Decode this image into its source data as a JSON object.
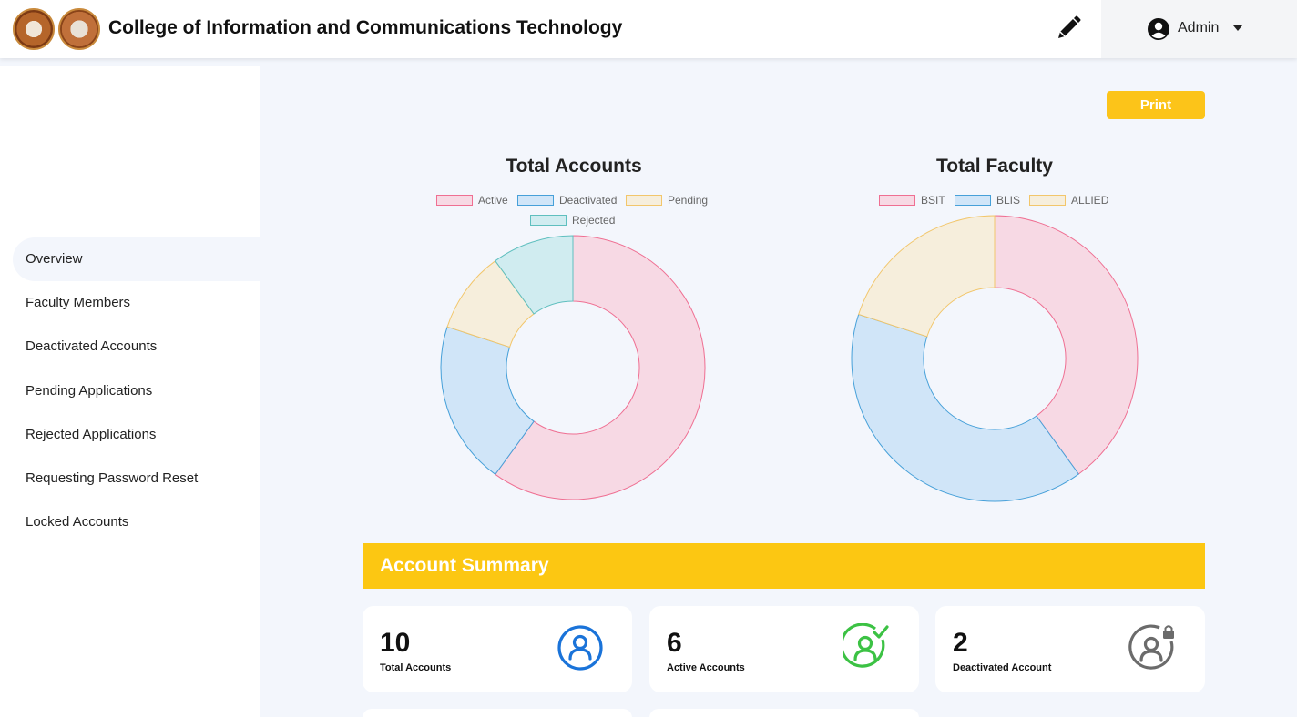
{
  "header": {
    "title": "College of Information and Communications Technology",
    "admin_label": "Admin",
    "edit_icon": "pencil-icon",
    "user_icon": "user-circle-icon"
  },
  "sidebar": {
    "items": [
      {
        "label": "Overview",
        "active": true
      },
      {
        "label": "Faculty Members"
      },
      {
        "label": "Deactivated Accounts"
      },
      {
        "label": "Pending Applications"
      },
      {
        "label": "Rejected Applications"
      },
      {
        "label": "Requesting Password Reset"
      },
      {
        "label": "Locked Accounts"
      }
    ]
  },
  "main": {
    "print_label": "Print",
    "summary_title": "Account Summary",
    "cards": [
      {
        "value": "10",
        "label": "Total Accounts",
        "icon": "user-circle-icon",
        "color": "#1a73d9"
      },
      {
        "value": "6",
        "label": "Active Accounts",
        "icon": "user-check-icon",
        "color": "#3cc244"
      },
      {
        "value": "2",
        "label": "Deactivated Account",
        "icon": "user-lock-icon",
        "color": "#6b6b6b"
      }
    ]
  },
  "chart_data": [
    {
      "type": "pie",
      "title": "Total Accounts",
      "categories": [
        "Active",
        "Deactivated",
        "Pending",
        "Rejected"
      ],
      "values": [
        6,
        2,
        1,
        1
      ],
      "colors": {
        "fill": [
          "#f7d9e4",
          "#d0e5f8",
          "#f6eedc",
          "#d0ecf0"
        ],
        "stroke": [
          "#ef6f92",
          "#46a0d9",
          "#f2c66b",
          "#5fbfbf"
        ]
      },
      "legend_position": "top"
    },
    {
      "type": "pie",
      "title": "Total Faculty",
      "categories": [
        "BSIT",
        "BLIS",
        "ALLIED"
      ],
      "values": [
        4,
        4,
        2
      ],
      "colors": {
        "fill": [
          "#f7d9e4",
          "#d0e5f8",
          "#f6eedc"
        ],
        "stroke": [
          "#ef6f92",
          "#46a0d9",
          "#f2c66b"
        ]
      },
      "legend_position": "top"
    }
  ]
}
